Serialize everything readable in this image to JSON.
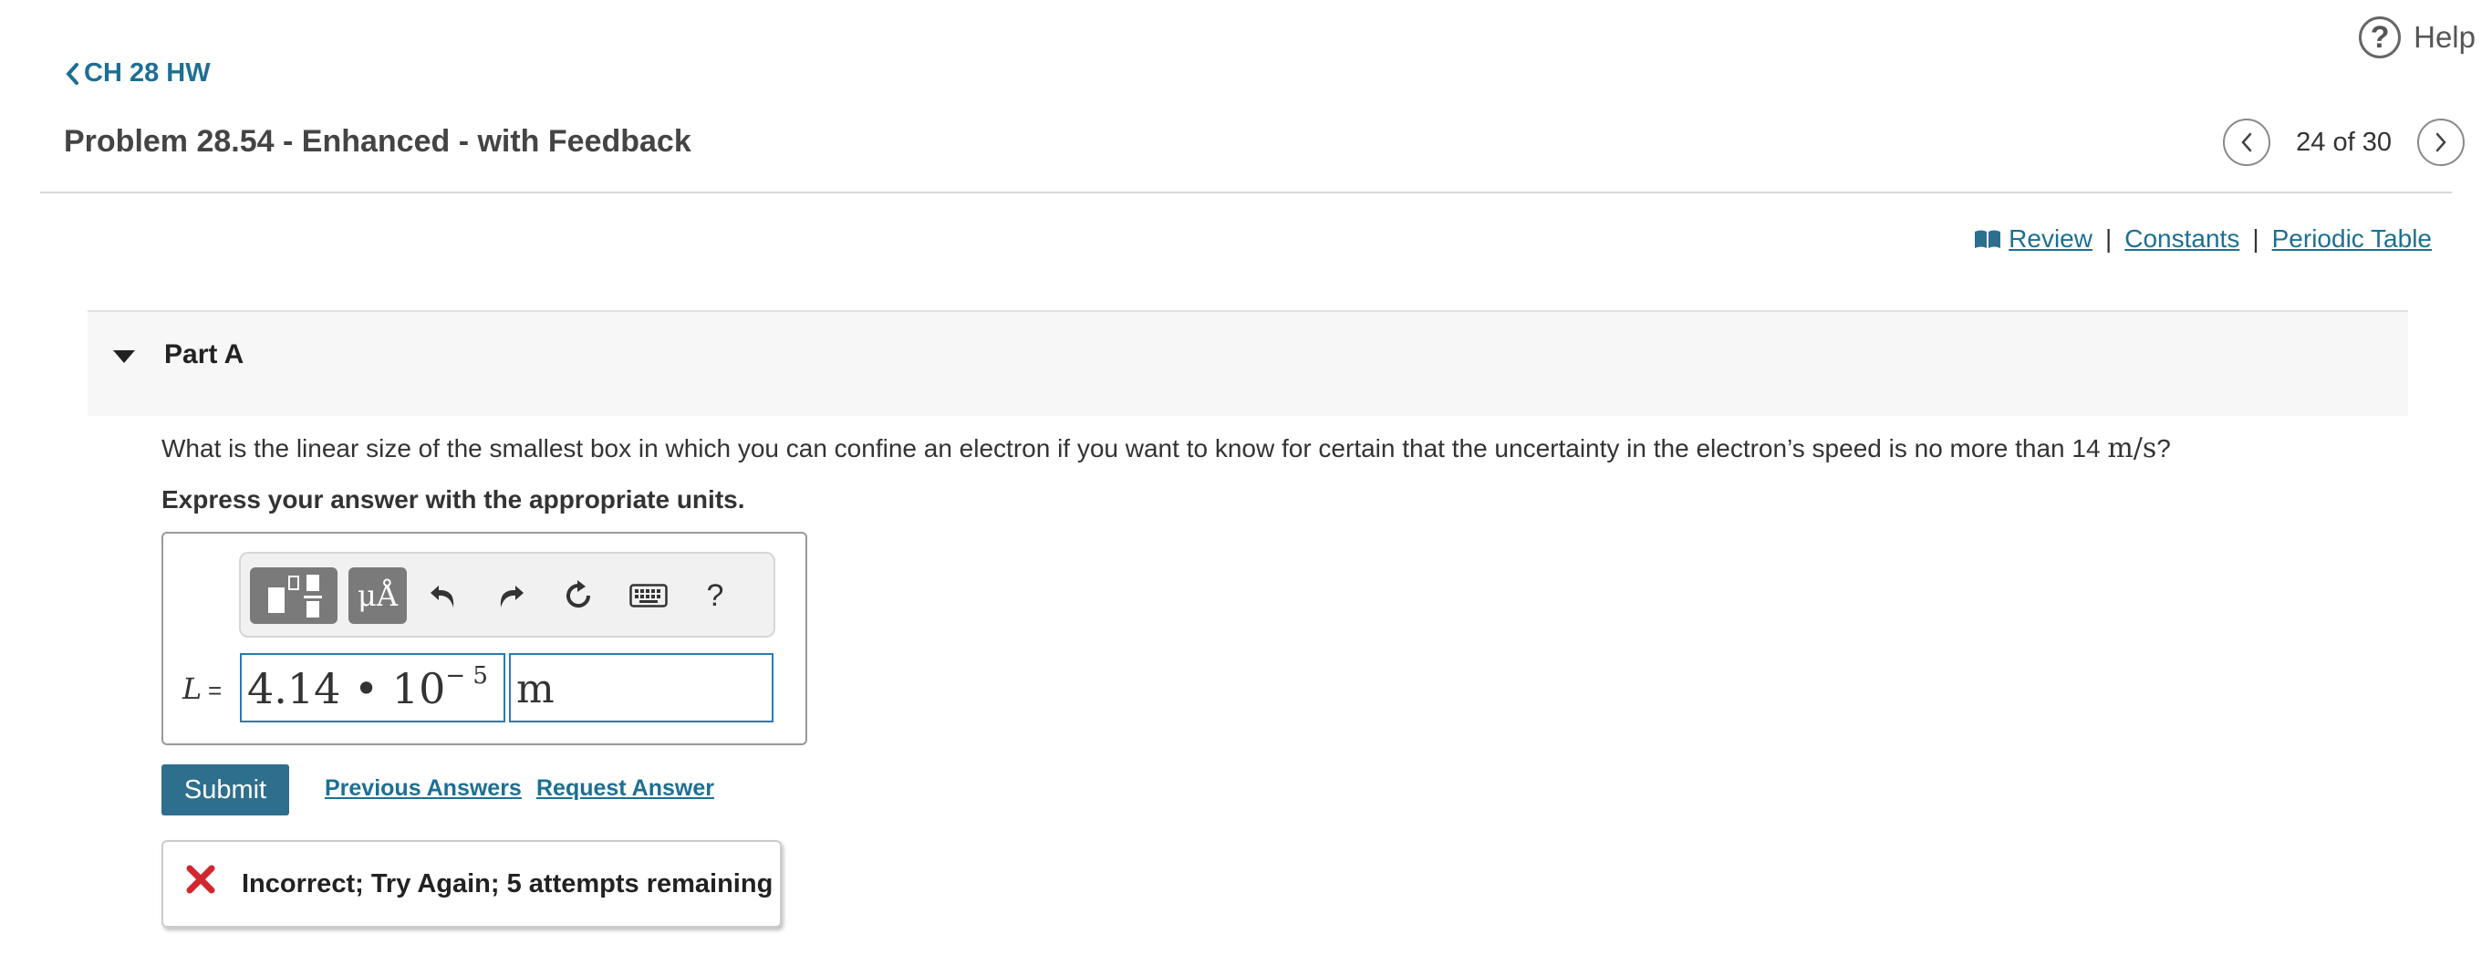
{
  "header": {
    "help_label": "Help",
    "back_label": "CH 28 HW",
    "problem_title": "Problem 28.54 - Enhanced - with Feedback",
    "pager_text": "24 of 30"
  },
  "resources": {
    "review": "Review",
    "separator": "|",
    "constants": "Constants",
    "periodic_table": "Periodic Table"
  },
  "part": {
    "label": "Part A",
    "question_text": "What is the linear size of the smallest box in which you can confine an electron if you want to know for certain that the uncertainty in the electron’s speed is no more than 14 ",
    "question_units": "m/s",
    "question_end": "?",
    "instruction": "Express your answer with the appropriate units."
  },
  "answer": {
    "variable": "L",
    "equals": "=",
    "value_mantissa": "4.14 • 10",
    "value_exponent": "− 5",
    "unit": "m"
  },
  "toolbar": {
    "units_icon_label": "μÅ",
    "help_label": "?"
  },
  "actions": {
    "submit": "Submit",
    "previous_answers": "Previous Answers",
    "request_answer": "Request Answer"
  },
  "feedback": {
    "message": "Incorrect; Try Again; 5 attempts remaining",
    "status_color": "#d0282e"
  },
  "colors": {
    "accent": "#1d6f93",
    "button": "#2e6f8e"
  }
}
